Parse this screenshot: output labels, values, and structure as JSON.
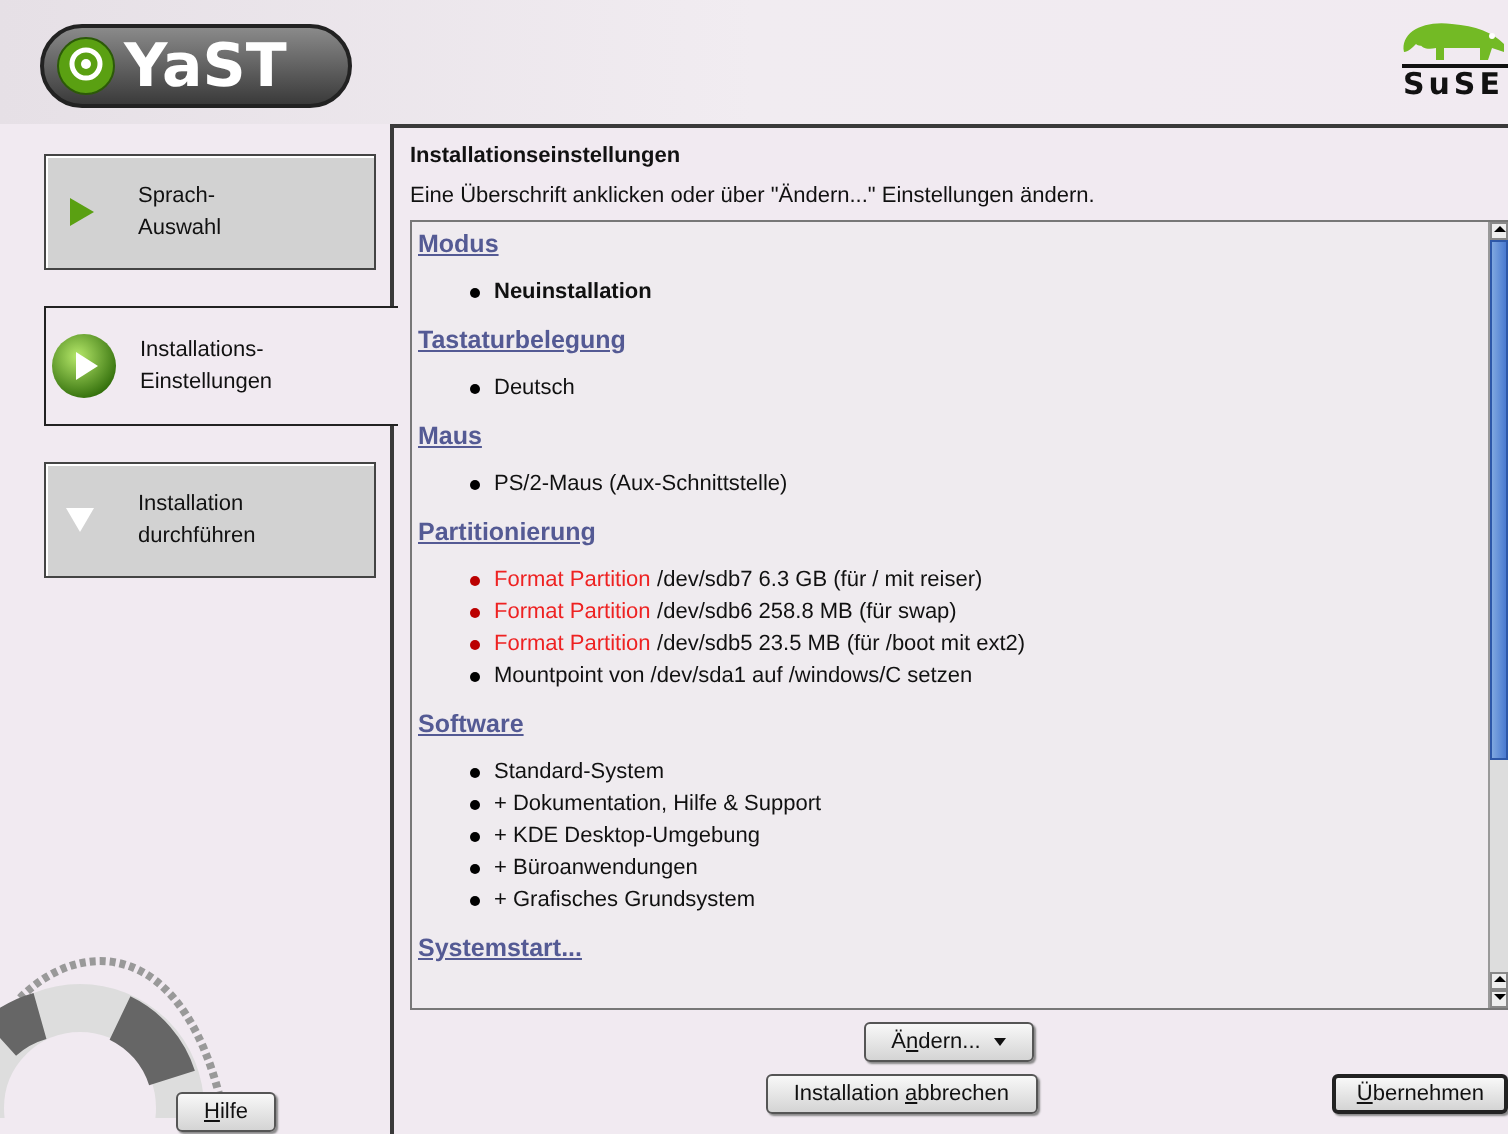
{
  "header": {
    "logo_text": "YaST",
    "brand_text": "SuSE"
  },
  "steps": [
    {
      "label": "Sprach-\nAuswahl",
      "kind": "done",
      "selected": false
    },
    {
      "label": "Installations-\nEinstellungen",
      "kind": "current",
      "selected": true
    },
    {
      "label": "Installation\ndurchführen",
      "kind": "pending",
      "selected": false
    }
  ],
  "help_button": {
    "key": "H",
    "after": "ilfe"
  },
  "panel": {
    "title": "Installationseinstellungen",
    "description": "Eine Überschrift anklicken oder über \"Ändern...\" Einstellungen ändern."
  },
  "sections": [
    {
      "title": "Modus",
      "items": [
        {
          "kind": "bold",
          "text": "Neuinstallation"
        }
      ]
    },
    {
      "title": "Tastaturbelegung",
      "items": [
        {
          "kind": "plain",
          "text": "Deutsch"
        }
      ]
    },
    {
      "title": "Maus",
      "items": [
        {
          "kind": "plain",
          "text": "PS/2-Maus (Aux-Schnittstelle)"
        }
      ]
    },
    {
      "title": "Partitionierung",
      "items": [
        {
          "kind": "warning",
          "tag": "Format Partition",
          "text": "/dev/sdb7 6.3 GB (für / mit reiser)"
        },
        {
          "kind": "warning",
          "tag": "Format Partition",
          "text": "/dev/sdb6 258.8 MB (für swap)"
        },
        {
          "kind": "warning",
          "tag": "Format Partition",
          "text": "/dev/sdb5 23.5 MB (für /boot mit ext2)"
        },
        {
          "kind": "plain",
          "text": "Mountpoint von /dev/sda1 auf /windows/C setzen"
        }
      ]
    },
    {
      "title": "Software",
      "items": [
        {
          "kind": "plain",
          "text": "Standard-System"
        },
        {
          "kind": "plain",
          "text": "+ Dokumentation, Hilfe & Support"
        },
        {
          "kind": "plain",
          "text": "+ KDE Desktop-Umgebung"
        },
        {
          "kind": "plain",
          "text": "+ Büroanwendungen"
        },
        {
          "kind": "plain",
          "text": "+ Grafisches Grundsystem"
        }
      ]
    },
    {
      "title": "Systemstart..."
    }
  ],
  "change_button": {
    "before": "Ä",
    "key": "n",
    "after": "dern..."
  },
  "buttons": [
    {
      "kind": "cancel",
      "before": "Installation ",
      "key": "a",
      "after": "bbrechen"
    },
    {
      "kind": "accept",
      "key": "Ü",
      "after": "bernehmen"
    }
  ]
}
